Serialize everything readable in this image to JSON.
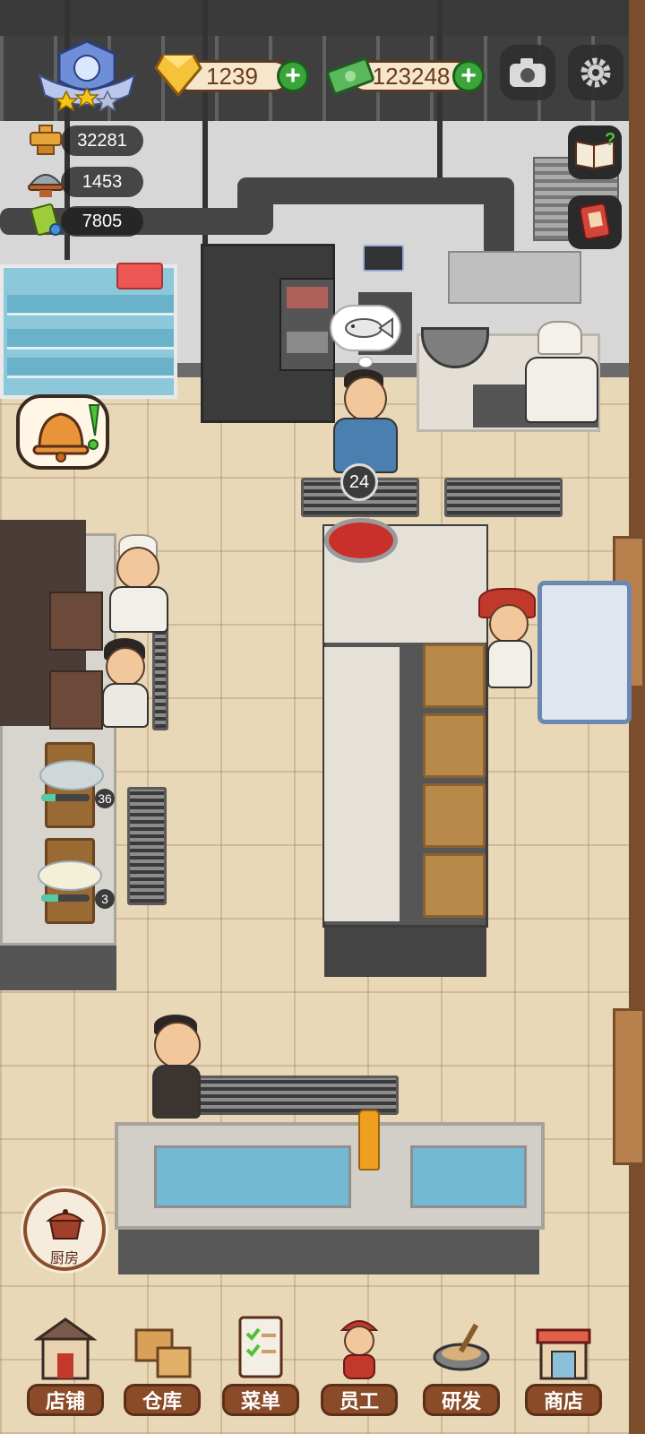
{
  "hud": {
    "gems": "1239",
    "cash": "123248",
    "stats": [
      {
        "icon": "hotpot-icon",
        "value": "32281"
      },
      {
        "icon": "cloche-icon",
        "value": "1453"
      },
      {
        "icon": "recipe-book-icon",
        "value": "7805"
      }
    ],
    "rating_stars": 2,
    "rating_stars_total": 3
  },
  "scene": {
    "order_timer": "24",
    "dish_counts": [
      "36",
      "3"
    ],
    "dish_progress": [
      0.3,
      0.35
    ]
  },
  "kitchen_button": {
    "label": "厨房"
  },
  "nav": [
    {
      "label": "店铺",
      "icon": "shop-building-icon"
    },
    {
      "label": "仓库",
      "icon": "warehouse-boxes-icon"
    },
    {
      "label": "菜单",
      "icon": "menu-clipboard-icon"
    },
    {
      "label": "员工",
      "icon": "staff-waiter-icon"
    },
    {
      "label": "研发",
      "icon": "research-wok-icon"
    },
    {
      "label": "商店",
      "icon": "store-front-icon"
    }
  ],
  "colors": {
    "accent_green": "#3aa63a",
    "nav_brown": "#8a4b28",
    "floor": "#e9d8b8"
  }
}
